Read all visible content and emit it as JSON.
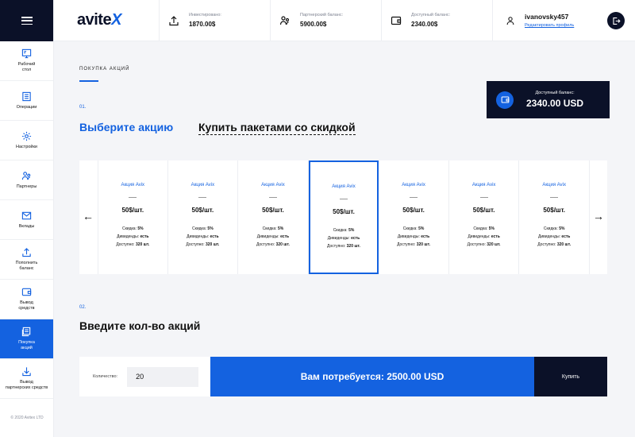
{
  "sidebar": {
    "items": [
      {
        "label": "Рабочий\nстол",
        "icon": "desktop-icon"
      },
      {
        "label": "Операции",
        "icon": "list-icon"
      },
      {
        "label": "Настройки",
        "icon": "gear-icon"
      },
      {
        "label": "Партнеры",
        "icon": "partners-icon"
      },
      {
        "label": "Вклады",
        "icon": "mail-icon"
      },
      {
        "label": "Пополнить\nбаланс",
        "icon": "upload-icon"
      },
      {
        "label": "Вывод\nсредств",
        "icon": "wallet-icon"
      },
      {
        "label": "Покупка\nакций",
        "icon": "stocks-icon"
      },
      {
        "label": "Вывод\nпартнерских средств",
        "icon": "download-icon"
      }
    ],
    "copyright": "© 2020 Avitex LTD"
  },
  "header": {
    "logo_main": "avite",
    "logo_x": "X",
    "invested_label": "Инвестировано:",
    "invested_value": "1870.00$",
    "partner_label": "Партнерский баланс:",
    "partner_value": "5900.00$",
    "available_label": "Доступный баланс:",
    "available_value": "2340.00$",
    "username": "ivanovsky457",
    "edit_profile": "Редактировать профиль"
  },
  "main": {
    "page_title": "ПОКУПКА АКЦИЙ",
    "balance_label": "Доступный баланс:",
    "balance_value": "2340.00 USD",
    "step1": "01.",
    "tab_active": "Выберите акцию",
    "tab_other": "Купить пакетами со скидкой",
    "step2": "02.",
    "qty_title": "Введите кол-во акций",
    "qty_label": "Количество:",
    "qty_value": "20",
    "need_text": "Вам потребуется: 2500.00 USD",
    "buy_label": "Купить",
    "prev_arrow": "←",
    "next_arrow": "→"
  },
  "cards": [
    {
      "name": "Акция Avix",
      "price": "50$/шт.",
      "discount_label": "Скидка:",
      "discount": "5%",
      "dividend_label": "Дивиденды:",
      "dividend": "есть",
      "available_label": "Доступно:",
      "available": "320 шт."
    },
    {
      "name": "Акция Avix",
      "price": "50$/шт.",
      "discount_label": "Скидка:",
      "discount": "5%",
      "dividend_label": "Дивиденды:",
      "dividend": "есть",
      "available_label": "Доступно:",
      "available": "320 шт."
    },
    {
      "name": "Акция Avix",
      "price": "50$/шт.",
      "discount_label": "Скидка:",
      "discount": "5%",
      "dividend_label": "Дивиденды:",
      "dividend": "есть",
      "available_label": "Доступно:",
      "available": "320 шт."
    },
    {
      "name": "Акция Avix",
      "price": "50$/шт.",
      "discount_label": "Скидка:",
      "discount": "5%",
      "dividend_label": "Дивиденды:",
      "dividend": "есть",
      "available_label": "Доступно:",
      "available": "320 шт."
    },
    {
      "name": "Акция Avix",
      "price": "50$/шт.",
      "discount_label": "Скидка:",
      "discount": "5%",
      "dividend_label": "Дивиденды:",
      "dividend": "есть",
      "available_label": "Доступно:",
      "available": "320 шт."
    },
    {
      "name": "Акция Avix",
      "price": "50$/шт.",
      "discount_label": "Скидка:",
      "discount": "5%",
      "dividend_label": "Дивиденды:",
      "dividend": "есть",
      "available_label": "Доступно:",
      "available": "320 шт."
    },
    {
      "name": "Акция Avix",
      "price": "50$/шт.",
      "discount_label": "Скидка:",
      "discount": "5%",
      "dividend_label": "Дивиденды:",
      "dividend": "есть",
      "available_label": "Доступно:",
      "available": "320 шт."
    }
  ],
  "selected_card": 3,
  "active_nav": 7,
  "colors": {
    "accent": "#1462e0",
    "dark": "#0b1128"
  }
}
